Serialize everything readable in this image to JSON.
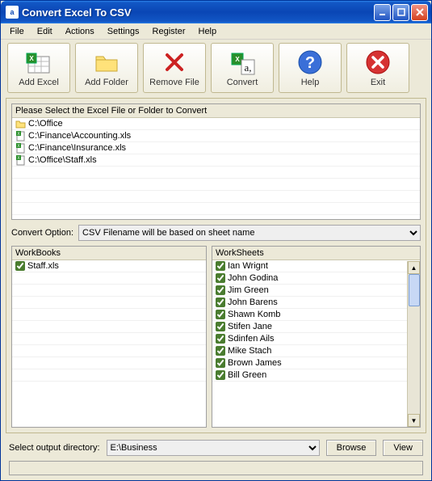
{
  "title": "Convert Excel To CSV",
  "menu": [
    "File",
    "Edit",
    "Actions",
    "Settings",
    "Register",
    "Help"
  ],
  "toolbar": [
    {
      "name": "add-excel",
      "label": "Add Excel"
    },
    {
      "name": "add-folder",
      "label": "Add Folder"
    },
    {
      "name": "remove-file",
      "label": "Remove File"
    },
    {
      "name": "convert",
      "label": "Convert"
    },
    {
      "name": "help",
      "label": "Help"
    },
    {
      "name": "exit",
      "label": "Exit"
    }
  ],
  "filelist": {
    "header": "Please Select the Excel File or Folder to Convert",
    "items": [
      {
        "type": "folder",
        "text": "C:\\Office"
      },
      {
        "type": "xls",
        "text": "C:\\Finance\\Accounting.xls"
      },
      {
        "type": "xls",
        "text": "C:\\Finance\\Insurance.xls"
      },
      {
        "type": "xls",
        "text": "C:\\Office\\Staff.xls"
      }
    ]
  },
  "convert_option": {
    "label": "Convert Option:",
    "value": "CSV Filename will be based on sheet name"
  },
  "workbooks": {
    "header": "WorkBooks",
    "items": [
      {
        "checked": true,
        "text": "Staff.xls"
      }
    ]
  },
  "worksheets": {
    "header": "WorkSheets",
    "items": [
      {
        "checked": true,
        "text": "Ian Wrignt"
      },
      {
        "checked": true,
        "text": "John Godina"
      },
      {
        "checked": true,
        "text": "Jim Green"
      },
      {
        "checked": true,
        "text": "John Barens"
      },
      {
        "checked": true,
        "text": "Shawn Komb"
      },
      {
        "checked": true,
        "text": "Stifen Jane"
      },
      {
        "checked": true,
        "text": "Sdinfen Ails"
      },
      {
        "checked": true,
        "text": "Mike Stach"
      },
      {
        "checked": true,
        "text": "Brown James"
      },
      {
        "checked": true,
        "text": "Bill Green"
      }
    ]
  },
  "output": {
    "label": "Select  output directory:",
    "value": "E:\\Business",
    "browse": "Browse",
    "view": "View"
  }
}
